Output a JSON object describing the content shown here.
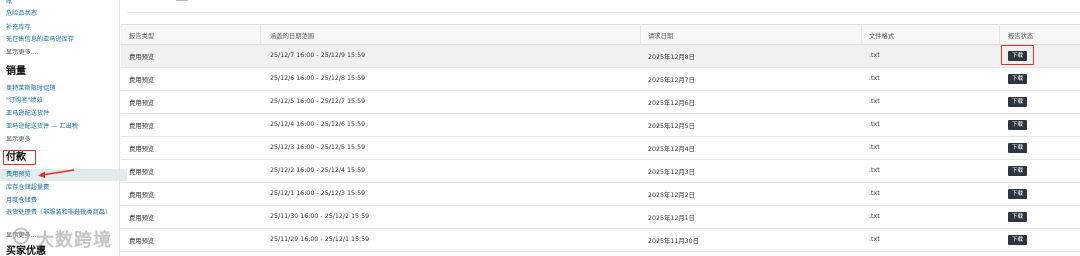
{
  "sidebar": {
    "top_items": [
      "账",
      "危险品状态",
      "补充库存",
      "无在售信息的亚马逊库存",
      "显示更多..."
    ],
    "sales_heading": "销量",
    "sales_items": [
      "奥特莱斯限时促销",
      "\"订购者\"绩效",
      "亚马逊配送货件",
      "亚马逊配送货件 — 汇出税",
      "显示更多"
    ],
    "payments_heading": "付款",
    "payments_items": [
      "费用预览",
      "库存仓储超量费",
      "月度仓储费",
      "退货处理费（非服装和非鞋靴类商品）",
      "显示更多..."
    ],
    "bottom_heading": "买家优惠"
  },
  "watermark": {
    "text": "大数跨境"
  },
  "table": {
    "headers": {
      "report_type": "报告类型",
      "date_range": "涵盖的日期范围",
      "request_date": "请求日期",
      "file_format": "文件格式",
      "status": "报告状态"
    },
    "download_label": "下载",
    "rows": [
      {
        "type": "费用预览",
        "range": "25/12/7 16:00 - 25/12/9 15:59",
        "requested": "2025年12月8日",
        "format": ".txt"
      },
      {
        "type": "费用预览",
        "range": "25/12/6 16:00 - 25/12/8 15:59",
        "requested": "2025年12月7日",
        "format": ".txt"
      },
      {
        "type": "费用预览",
        "range": "25/12/5 16:00 - 25/12/7 15:59",
        "requested": "2025年12月6日",
        "format": ".txt"
      },
      {
        "type": "费用预览",
        "range": "25/12/4 16:00 - 25/12/6 15:59",
        "requested": "2025年12月5日",
        "format": ".txt"
      },
      {
        "type": "费用预览",
        "range": "25/12/3 16:00 - 25/12/5 15:59",
        "requested": "2025年12月4日",
        "format": ".txt"
      },
      {
        "type": "费用预览",
        "range": "25/12/2 16:00 - 25/12/4 15:59",
        "requested": "2025年12月3日",
        "format": ".txt"
      },
      {
        "type": "费用预览",
        "range": "25/12/1 16:00 - 25/12/3 15:59",
        "requested": "2025年12月2日",
        "format": ".txt"
      },
      {
        "type": "费用预览",
        "range": "25/11/30 16:00 - 25/12/2 15:59",
        "requested": "2025年12月1日",
        "format": ".txt"
      },
      {
        "type": "费用预览",
        "range": "25/11/29 16:00 - 25/12/1 15:59",
        "requested": "2025年11月30日",
        "format": ".txt"
      }
    ]
  },
  "colors": {
    "link": "#1a6fa8",
    "callout": "#e0302a",
    "button": "#2d3640",
    "highlight_row": "#f0f0f0",
    "active_nav": "#e3ebec"
  }
}
